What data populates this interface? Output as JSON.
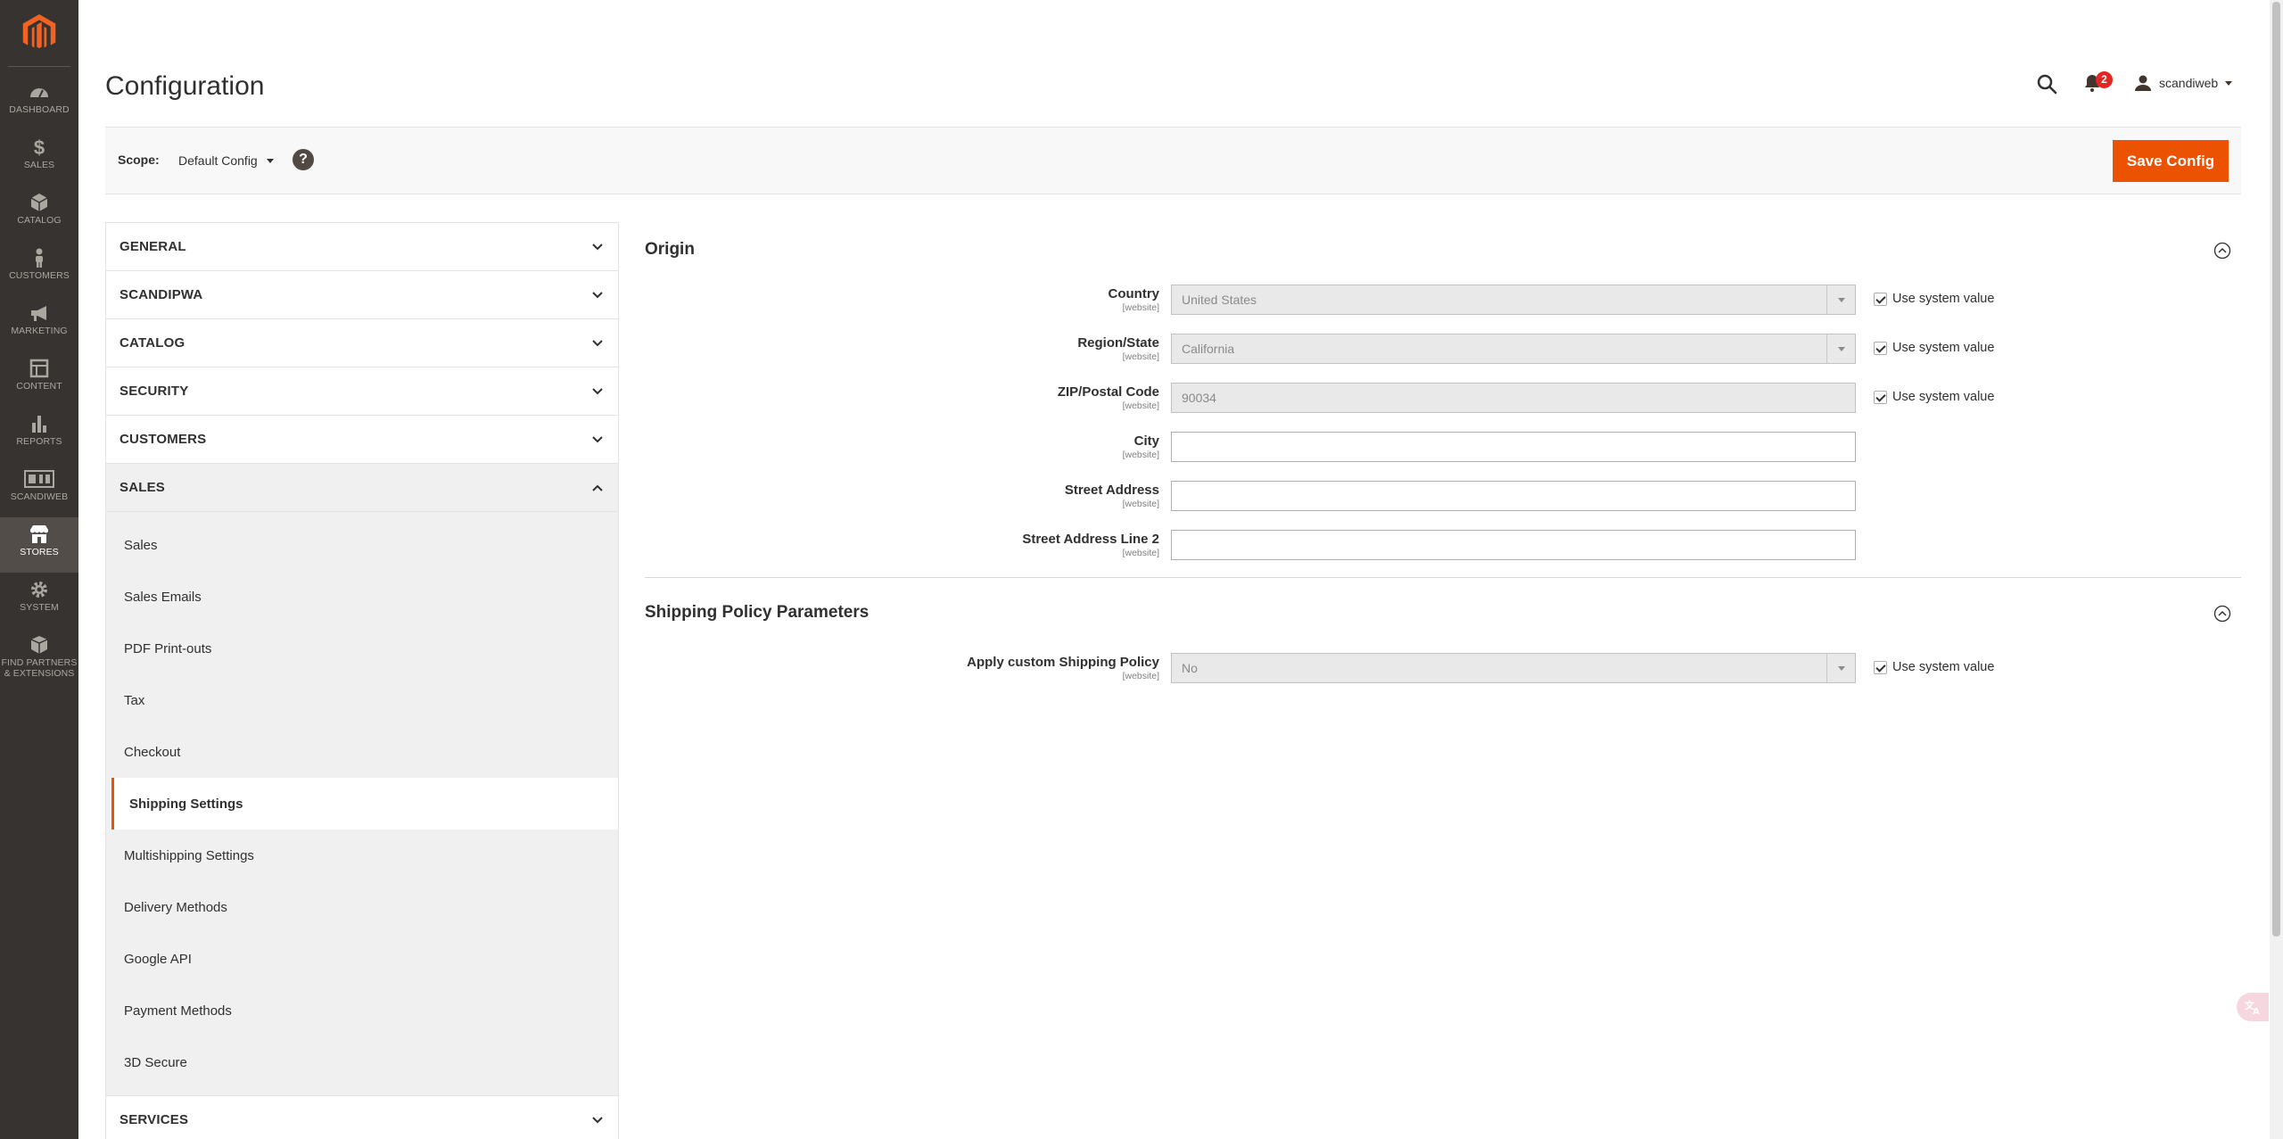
{
  "admin_nav": {
    "items": [
      {
        "label": "DASHBOARD",
        "icon": "dashboard-icon"
      },
      {
        "label": "SALES",
        "icon": "dollar-icon"
      },
      {
        "label": "CATALOG",
        "icon": "cube-icon"
      },
      {
        "label": "CUSTOMERS",
        "icon": "person-icon"
      },
      {
        "label": "MARKETING",
        "icon": "megaphone-icon"
      },
      {
        "label": "CONTENT",
        "icon": "layout-icon"
      },
      {
        "label": "REPORTS",
        "icon": "bar-chart-icon"
      },
      {
        "label": "SCANDIWEB",
        "icon": "scandiweb-icon"
      },
      {
        "label": "STORES",
        "icon": "store-icon"
      },
      {
        "label": "SYSTEM",
        "icon": "gear-icon"
      },
      {
        "label_line1": "FIND PARTNERS",
        "label_line2": "& EXTENSIONS",
        "icon": "box-icon"
      }
    ],
    "active": "STORES"
  },
  "header": {
    "title": "Configuration",
    "notification_count": "2",
    "user_name": "scandiweb"
  },
  "scope": {
    "label": "Scope:",
    "value": "Default Config",
    "help": "?",
    "save_label": "Save Config"
  },
  "tabs": {
    "groups": [
      {
        "label": "GENERAL"
      },
      {
        "label": "SCANDIPWA"
      },
      {
        "label": "CATALOG"
      },
      {
        "label": "SECURITY"
      },
      {
        "label": "CUSTOMERS"
      },
      {
        "label": "SALES"
      },
      {
        "label": "SERVICES"
      }
    ],
    "sales_items": [
      "Sales",
      "Sales Emails",
      "PDF Print-outs",
      "Tax",
      "Checkout",
      "Shipping Settings",
      "Multishipping Settings",
      "Delivery Methods",
      "Google API",
      "Payment Methods",
      "3D Secure"
    ],
    "active_item": "Shipping Settings"
  },
  "origin": {
    "title": "Origin",
    "fields": [
      {
        "label": "Country",
        "scope": "[website]",
        "value": "United States",
        "type": "select",
        "disabled": true,
        "use_system": "Use system value"
      },
      {
        "label": "Region/State",
        "scope": "[website]",
        "value": "California",
        "type": "select",
        "disabled": true,
        "use_system": "Use system value"
      },
      {
        "label": "ZIP/Postal Code",
        "scope": "[website]",
        "value": "90034",
        "type": "text",
        "disabled": true,
        "use_system": "Use system value"
      },
      {
        "label": "City",
        "scope": "[website]",
        "value": "",
        "type": "text",
        "disabled": false
      },
      {
        "label": "Street Address",
        "scope": "[website]",
        "value": "",
        "type": "text",
        "disabled": false
      },
      {
        "label": "Street Address Line 2",
        "scope": "[website]",
        "value": "",
        "type": "text",
        "disabled": false
      }
    ]
  },
  "shipping_policy": {
    "title": "Shipping Policy Parameters",
    "fields": [
      {
        "label": "Apply custom Shipping Policy",
        "scope": "[website]",
        "value": "No",
        "type": "select",
        "disabled": true,
        "use_system": "Use system value"
      }
    ]
  },
  "colors": {
    "accent": "#eb5202",
    "nav_bg": "#373330",
    "badge": "#e22626"
  }
}
